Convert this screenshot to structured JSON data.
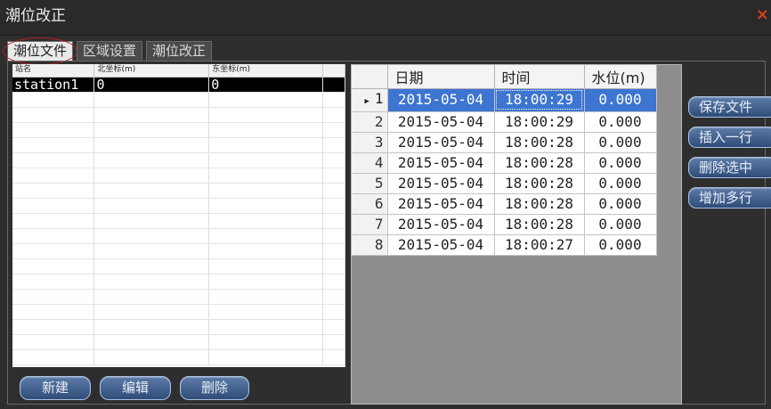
{
  "window": {
    "title": "潮位改正",
    "close_glyph": "×"
  },
  "tabs": [
    {
      "label": "潮位文件",
      "active": true
    },
    {
      "label": "区域设置",
      "active": false
    },
    {
      "label": "潮位改正",
      "active": false
    }
  ],
  "stations": {
    "headers": [
      "站名",
      "北坐标(m)",
      "东坐标(m)"
    ],
    "rows": [
      {
        "name": "station1",
        "north": "0",
        "east": "0"
      }
    ]
  },
  "left_buttons": {
    "new": "新建",
    "edit": "编辑",
    "delete": "删除"
  },
  "tide_table": {
    "headers": [
      "日期",
      "时间",
      "水位(m)"
    ],
    "rows": [
      {
        "no": "1",
        "date": "2015-05-04",
        "time": "18:00:29",
        "level": "0.000"
      },
      {
        "no": "2",
        "date": "2015-05-04",
        "time": "18:00:29",
        "level": "0.000"
      },
      {
        "no": "3",
        "date": "2015-05-04",
        "time": "18:00:28",
        "level": "0.000"
      },
      {
        "no": "4",
        "date": "2015-05-04",
        "time": "18:00:28",
        "level": "0.000"
      },
      {
        "no": "5",
        "date": "2015-05-04",
        "time": "18:00:28",
        "level": "0.000"
      },
      {
        "no": "6",
        "date": "2015-05-04",
        "time": "18:00:28",
        "level": "0.000"
      },
      {
        "no": "7",
        "date": "2015-05-04",
        "time": "18:00:28",
        "level": "0.000"
      },
      {
        "no": "8",
        "date": "2015-05-04",
        "time": "18:00:27",
        "level": "0.000"
      }
    ]
  },
  "right_buttons": {
    "save": "保存文件",
    "insert": "插入一行",
    "delete_selected": "删除选中",
    "add_rows": "增加多行"
  },
  "colors": {
    "selection": "#3d75d1",
    "button": "#3f5f8f",
    "close": "#d9431e"
  }
}
